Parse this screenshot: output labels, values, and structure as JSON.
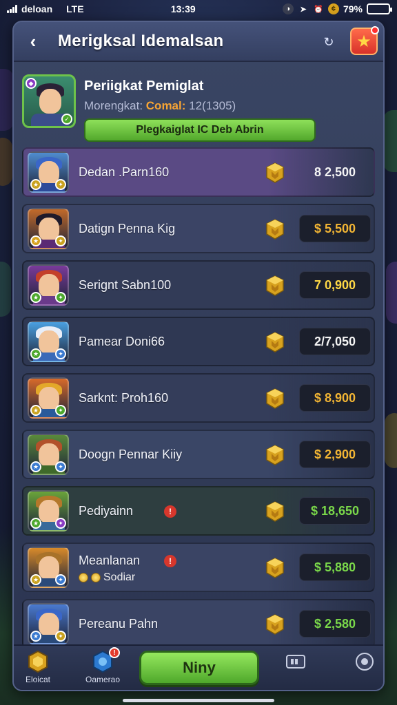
{
  "status_bar": {
    "carrier": "deloan",
    "network": "LTE",
    "time": "13:39",
    "battery": "79%",
    "battery_level": 0.79
  },
  "header": {
    "title": "Merigksal Idemalsan"
  },
  "profile": {
    "name": "Periigkat Pemiglat",
    "subtitle_prefix": "Morengkat:",
    "subtitle_accent": "Comal:",
    "subtitle_suffix": "12(1305)",
    "button_label": "Plegkaiglat IC Deb Abrin"
  },
  "rows": [
    {
      "name": "Dedan .Parn160",
      "price": "8 2,500",
      "price_style": "plain",
      "price_color": "#f4f4f4",
      "bg": "#5a4a84",
      "hair": "#3a66c8",
      "body": "#2c4a9a",
      "portrait_bg": "#4f8ccf"
    },
    {
      "name": "Datign Penna Kig",
      "price": "$ 5,500",
      "price_style": "boxed",
      "price_color": "#f2b534",
      "bg": "#3b4465",
      "hair": "#1f1a2a",
      "body": "#5b2a74",
      "portrait_bg": "#c26a2a"
    },
    {
      "name": "Serignt Sabn100",
      "price": "7 0,900",
      "price_style": "boxed",
      "price_color": "#ffd845",
      "bg": "#323b57",
      "hair": "#c4402a",
      "body": "#6a3a8a",
      "portrait_bg": "#7a3a9a"
    },
    {
      "name": "Pamear Doni66",
      "price": "2/7,050",
      "price_style": "boxed",
      "price_color": "#f4f4f4",
      "bg": "#2f3853",
      "hair": "#e8eef8",
      "body": "#3a6ab8",
      "portrait_bg": "#4aa0e0"
    },
    {
      "name": "Sarknt: Proh160",
      "price": "$ 8,900",
      "price_style": "boxed",
      "price_color": "#f2b534",
      "bg": "#343d5a",
      "hair": "#e3a82a",
      "body": "#2a5a9a",
      "portrait_bg": "#d86a2a"
    },
    {
      "name": "Doogn Pennar Kiiy",
      "price": "$ 2,900",
      "price_style": "boxed",
      "price_color": "#f2b534",
      "bg": "#3a4666",
      "hair": "#b2512a",
      "body": "#3f6a2a",
      "portrait_bg": "#5a8a3a"
    },
    {
      "name": "Pediyainn",
      "price": "$ 18,650",
      "price_style": "boxed",
      "price_color": "#7ad84a",
      "bg": "#2e3e40",
      "hair": "#b4782a",
      "body": "#3a6a9a",
      "portrait_bg": "#6aa43a"
    },
    {
      "name": "Meanlanan",
      "sub": "Sodiar",
      "price": "$ 5,880",
      "price_style": "boxed",
      "price_color": "#7ad84a",
      "bg": "#3a4464",
      "hair": "#a8722a",
      "body": "#2a4a7a",
      "portrait_bg": "#d88a2a"
    },
    {
      "name": "Pereanu Pahn",
      "price": "$ 2,580",
      "price_style": "boxed",
      "price_color": "#7ad84a",
      "bg": "#3a4464",
      "hair": "#3a66c8",
      "body": "#2a4a7a",
      "portrait_bg": "#4a7ad0"
    }
  ],
  "bottom_nav": {
    "left_label": "Eloicat",
    "second_label": "Oamerao",
    "second_badge": "!",
    "cta_label": "Niny"
  }
}
